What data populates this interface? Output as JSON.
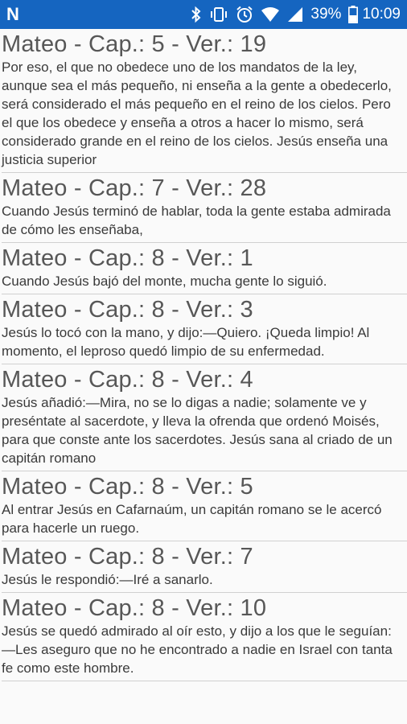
{
  "status_bar": {
    "app_icon_letter": "N",
    "battery_percent": "39%",
    "time": "10:09"
  },
  "verses": [
    {
      "reference": "Mateo - Cap.: 5 - Ver.: 19",
      "text": "Por eso, el que no obedece uno de los mandatos de la ley, aunque sea el más pequeño, ni enseña a la gente a obedecerlo, será considerado el más pequeño en el reino de los cielos. Pero el que los obedece y enseña a otros a hacer lo mismo, será considerado grande en el reino de los cielos. Jesús enseña una justicia superior"
    },
    {
      "reference": "Mateo - Cap.: 7 - Ver.: 28",
      "text": "Cuando Jesús terminó de hablar, toda la gente estaba admirada de cómo les enseñaba,"
    },
    {
      "reference": "Mateo - Cap.: 8 - Ver.: 1",
      "text": "Cuando Jesús bajó del monte, mucha gente lo siguió."
    },
    {
      "reference": "Mateo - Cap.: 8 - Ver.: 3",
      "text": "Jesús lo tocó con la mano, y dijo:—Quiero. ¡Queda limpio! Al momento, el leproso quedó limpio de su enfermedad."
    },
    {
      "reference": "Mateo - Cap.: 8 - Ver.: 4",
      "text": "Jesús añadió:—Mira, no se lo digas a nadie; solamente ve y preséntate al sacerdote, y lleva la ofrenda que ordenó Moisés, para que conste ante los sacerdotes. Jesús sana al criado de un capitán romano"
    },
    {
      "reference": "Mateo - Cap.: 8 - Ver.: 5",
      "text": "Al entrar Jesús en Cafarnaúm, un capitán romano se le acercó para hacerle un ruego."
    },
    {
      "reference": "Mateo - Cap.: 8 - Ver.: 7",
      "text": "Jesús le respondió:—Iré a sanarlo."
    },
    {
      "reference": "Mateo - Cap.: 8 - Ver.: 10",
      "text": "Jesús se quedó admirado al oír esto, y dijo a los que le seguían:—Les aseguro que no he encontrado a nadie en Israel con tanta fe como este hombre."
    }
  ]
}
